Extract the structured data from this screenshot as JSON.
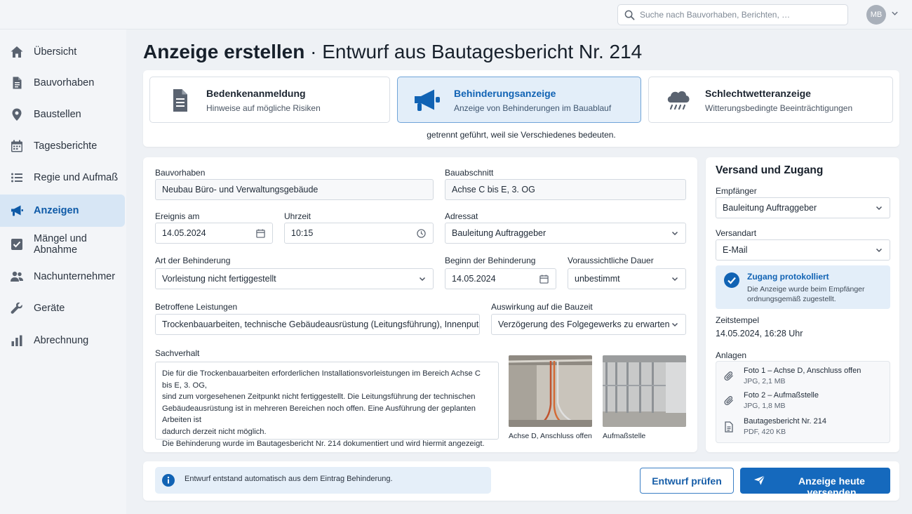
{
  "header": {
    "search_placeholder": "Suche nach Bauvorhaben, Berichten, …",
    "user_initials": "MB"
  },
  "sidebar": {
    "items": [
      {
        "label": "Übersicht",
        "icon": "home-icon"
      },
      {
        "label": "Bauvorhaben",
        "icon": "document-icon"
      },
      {
        "label": "Baustellen",
        "icon": "location-pin-icon"
      },
      {
        "label": "Tagesberichte",
        "icon": "calendar-icon"
      },
      {
        "label": "Regie und Aufmaß",
        "icon": "list-icon"
      },
      {
        "label": "Anzeigen",
        "icon": "megaphone-icon",
        "active": true
      },
      {
        "label": "Mängel und Abnahme",
        "icon": "checkbox-icon"
      },
      {
        "label": "Nachunternehmer",
        "icon": "people-icon"
      },
      {
        "label": "Geräte",
        "icon": "wrench-icon"
      },
      {
        "label": "Abrechnung",
        "icon": "bar-chart-icon"
      }
    ]
  },
  "page": {
    "title": "Anzeige erstellen",
    "separator": " · ",
    "subtitle": "Entwurf aus Bautagesbericht Nr. 214"
  },
  "types": {
    "items": [
      {
        "title": "Bedenkenanmeldung",
        "desc": "Hinweise auf mögliche Risiken",
        "icon": "document-icon"
      },
      {
        "title": "Behinderungsanzeige",
        "desc": "Anzeige von Behinderungen im Bauablauf",
        "icon": "megaphone-icon",
        "selected": true
      },
      {
        "title": "Schlechtwetteranzeige",
        "desc": "Witterungsbedingte Beeinträchtigungen",
        "icon": "rain-cloud-icon"
      }
    ],
    "note": "getrennt geführt, weil sie Verschiedenes bedeuten."
  },
  "form": {
    "bauvorhaben_label": "Bauvorhaben",
    "bauvorhaben_value": "Neubau Büro- und Verwaltungsgebäude",
    "bauabschnitt_label": "Bauabschnitt",
    "bauabschnitt_value": "Achse C bis E, 3. OG",
    "ereignis_label": "Ereignis am",
    "ereignis_value": "14.05.2024",
    "uhrzeit_label": "Uhrzeit",
    "uhrzeit_value": "10:15",
    "adressat_label": "Adressat",
    "adressat_value": "Bauleitung Auftraggeber",
    "art_label": "Art der Behinderung",
    "art_value": "Vorleistung nicht fertiggestellt",
    "beginn_label": "Beginn der Behinderung",
    "beginn_value": "14.05.2024",
    "dauer_label": "Voraussichtliche Dauer",
    "dauer_value": "unbestimmt",
    "leistungen_label": "Betroffene Leistungen",
    "leistungen_value": "Trockenbauarbeiten, technische Gebäudeausrüstung (Leitungsführung), Innenputz",
    "auswirkung_label": "Auswirkung auf die Bauzeit",
    "auswirkung_value": "Verzögerung des Folgegewerks zu erwarten",
    "sachverhalt_label": "Sachverhalt",
    "sachverhalt_lines": [
      "Die für die Trockenbauarbeiten erforderlichen Installationsvorleistungen im Bereich Achse C bis E, 3. OG,",
      "sind zum vorgesehenen Zeitpunkt nicht fertiggestellt. Die Leitungsführung der technischen",
      "Gebäudeausrüstung ist in mehreren Bereichen noch offen. Eine Ausführung der geplanten Arbeiten ist",
      "dadurch derzeit nicht möglich.",
      "Die Behinderung wurde im Bautagesbericht Nr. 214 dokumentiert und wird hiermit angezeigt."
    ],
    "photos": [
      {
        "caption": "Achse D, Anschluss offen"
      },
      {
        "caption": "Aufmaßstelle"
      }
    ]
  },
  "side": {
    "heading": "Versand und Zugang",
    "empfaenger_label": "Empfänger",
    "empfaenger_value": "Bauleitung Auftraggeber",
    "versandart_label": "Versandart",
    "versandart_value": "E-Mail",
    "status_title": "Zugang protokolliert",
    "status_line1": "Die Anzeige wurde beim Empfänger",
    "status_line2": "ordnungsgemäß zugestellt.",
    "zeitstempel_label": "Zeitstempel",
    "zeitstempel_value": "14.05.2024, 16:28 Uhr",
    "anlagen_label": "Anlagen",
    "attachments": [
      {
        "name": "Foto 1 – Achse D, Anschluss offen",
        "meta": "JPG, 2,1 MB",
        "icon": "paperclip-icon"
      },
      {
        "name": "Foto 2 – Aufmaßstelle",
        "meta": "JPG, 1,8 MB",
        "icon": "paperclip-icon"
      },
      {
        "name": "Bautagesbericht Nr. 214",
        "meta": "PDF, 420 KB",
        "icon": "document-icon"
      }
    ]
  },
  "footer": {
    "info_text": "Entwurf entstand automatisch aus dem Eintrag Behinderung.",
    "check_label": "Entwurf prüfen",
    "send_label": "Anzeige heute versenden"
  },
  "colors": {
    "accent": "#1569bd",
    "active_bg": "#d7e6f5",
    "selected_card_bg": "#e3eef9"
  }
}
